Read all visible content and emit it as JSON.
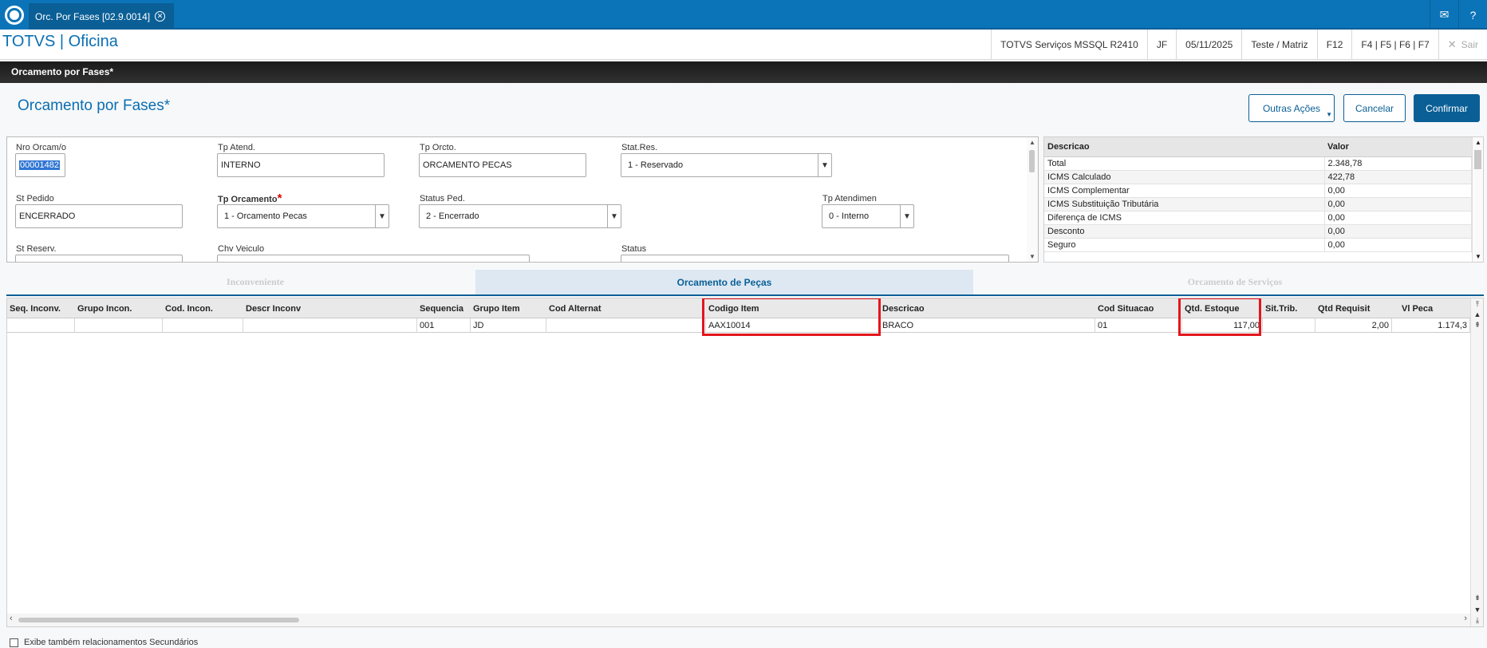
{
  "topbar": {
    "tab_label": "Orc. Por Fases [02.9.0014]",
    "icons": [
      "totvs-logo-icon",
      "close-tab-icon",
      "mail-icon",
      "help-icon"
    ]
  },
  "header": {
    "app_title": "TOTVS | Oficina",
    "environment": "TOTVS Serviços MSSQL R2410",
    "user": "JF",
    "date": "05/11/2025",
    "company": "Teste / Matriz",
    "shortcut_f12": "F12",
    "shortcuts": "F4 | F5 | F6 | F7",
    "exit_label": "Sair"
  },
  "window": {
    "title": "Orcamento por Fases*",
    "page_title": "Orcamento por Fases*"
  },
  "actions": {
    "other_actions": "Outras Ações",
    "cancel": "Cancelar",
    "confirm": "Confirmar"
  },
  "form": {
    "nro_orcamento": {
      "label": "Nro Orcam/o",
      "value": "00001482"
    },
    "tp_atend": {
      "label": "Tp Atend.",
      "value": "INTERNO"
    },
    "tp_orcto": {
      "label": "Tp Orcto.",
      "value": "ORCAMENTO PECAS"
    },
    "stat_res": {
      "label": "Stat.Res.",
      "value": "1 - Reservado"
    },
    "st_pedido": {
      "label": "St Pedido",
      "value": "ENCERRADO"
    },
    "tp_orcamento": {
      "label": "Tp Orcamento",
      "value": "1 - Orcamento Pecas"
    },
    "status_ped": {
      "label": "Status Ped.",
      "value": "2 - Encerrado"
    },
    "tp_atendimen": {
      "label": "Tp Atendimen",
      "value": "0 - Interno"
    },
    "st_reserv": {
      "label": "St Reserv."
    },
    "chv_veiculo": {
      "label": "Chv Veiculo"
    },
    "status": {
      "label": "Status"
    }
  },
  "totals": {
    "headers": [
      "Descricao",
      "Valor"
    ],
    "rows": [
      [
        "Total",
        "2.348,78"
      ],
      [
        "ICMS Calculado",
        "422,78"
      ],
      [
        "ICMS Complementar",
        "0,00"
      ],
      [
        "ICMS Substituição Tributária",
        "0,00"
      ],
      [
        "Diferença de ICMS",
        "0,00"
      ],
      [
        "Desconto",
        "0,00"
      ],
      [
        "Seguro",
        "0,00"
      ]
    ]
  },
  "folders": {
    "tabs": [
      "Inconveniente",
      "Orcamento de Peças",
      "Orcamento de Serviços"
    ],
    "active": 1
  },
  "grid": {
    "headers": [
      "Seq. Inconv.",
      "Grupo Incon.",
      "Cod. Incon.",
      "Descr Inconv",
      "Sequencia",
      "Grupo Item",
      "Cod Alternat",
      "Codigo Item",
      "Descricao",
      "Cod Situacao",
      "Qtd. Estoque",
      "Sit.Trib.",
      "Qtd Requisit",
      "Vl Peca"
    ],
    "rows": [
      [
        "",
        "",
        "",
        "",
        "001",
        "JD",
        "",
        "AAX10014",
        "BRACO",
        "01",
        "117,00",
        "",
        "2,00",
        "1.174,3"
      ]
    ]
  },
  "footer": {
    "checkbox_label": "Exibe também relacionamentos Secundários"
  }
}
